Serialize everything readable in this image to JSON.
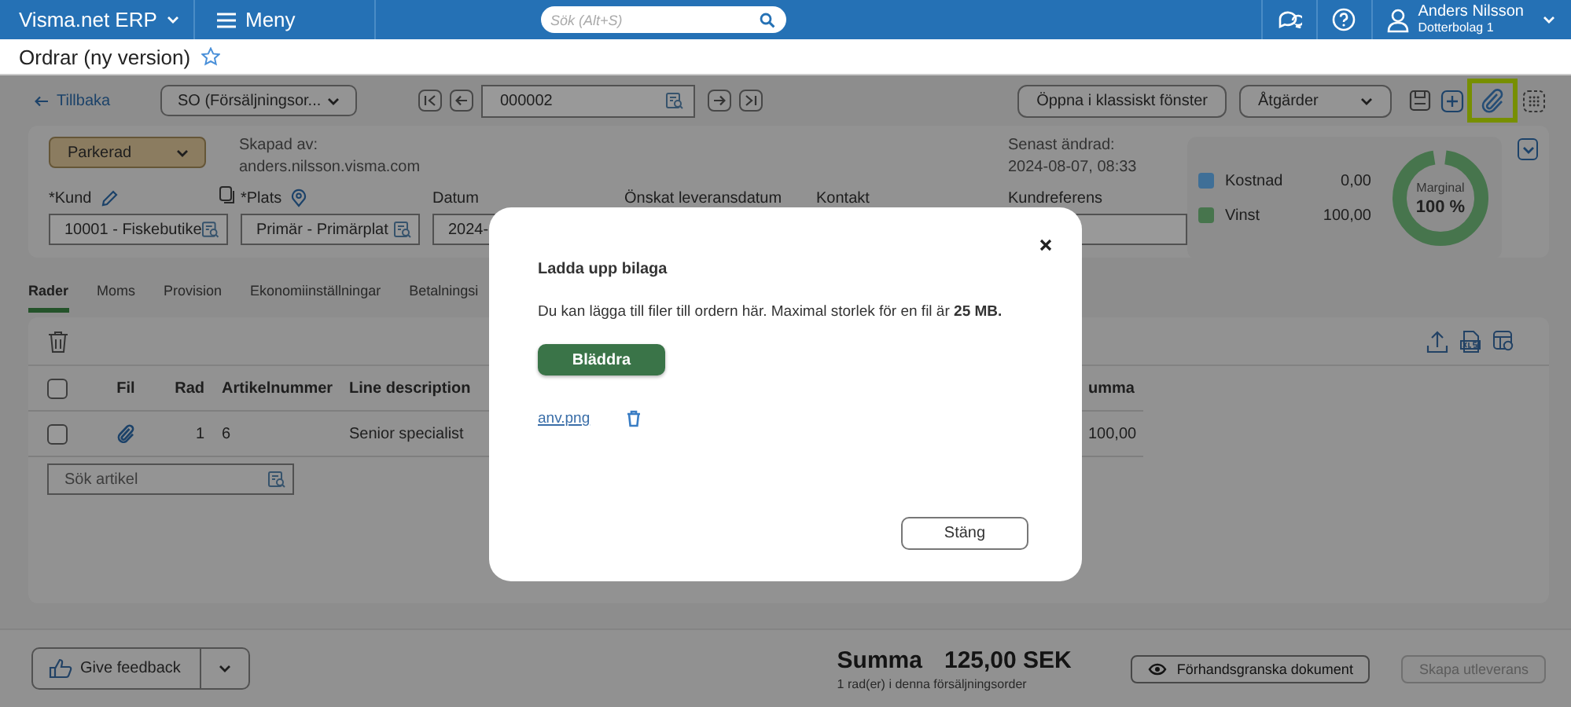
{
  "topbar": {
    "app_name": "Visma.net ERP",
    "menu_label": "Meny",
    "search": {
      "placeholder": "Sök (Alt+S)"
    },
    "user": {
      "name": "Anders Nilsson",
      "company": "Dotterbolag 1"
    }
  },
  "page": {
    "title": "Ordrar (ny version)",
    "favorite": false
  },
  "toolbar": {
    "back": "Tillbaka",
    "order_type": "SO (Försäljningsor...",
    "order_number": "000002",
    "buttons": [
      {
        "label": "Öppna i klassiskt fönster",
        "kind": "button"
      },
      {
        "label": "Åtgärder",
        "kind": "dropdown"
      }
    ],
    "icon_buttons": [
      {
        "kind": "save",
        "highlighted": false
      },
      {
        "kind": "add",
        "highlighted": false
      },
      {
        "kind": "attach",
        "highlighted": true
      },
      {
        "kind": "grid",
        "highlighted": false
      }
    ]
  },
  "header": {
    "status": "Parkerad",
    "created_by_label": "Skapad av:",
    "created_by": "anders.nilsson.visma.com",
    "modified_label": "Senast ändrad:",
    "modified": "2024-08-07, 08:33",
    "fields": [
      {
        "label": "*Kund",
        "kind": "lookup",
        "editable": true,
        "copyable": true,
        "located": false,
        "value": "10001 - Fiskebutike"
      },
      {
        "label": "*Plats",
        "kind": "lookup",
        "editable": false,
        "copyable": false,
        "located": true,
        "value": "Primär - Primärplat"
      },
      {
        "label": "Datum",
        "kind": "text",
        "value": "2024-"
      },
      {
        "label": "Önskat leveransdatum",
        "kind": "label"
      },
      {
        "label": "Kontakt",
        "kind": "label"
      },
      {
        "label": "Kundreferens",
        "kind": "text"
      }
    ],
    "summary": {
      "legend": [
        {
          "label": "Kostnad",
          "value": "0,00",
          "color": "#3f6f97"
        },
        {
          "label": "Vinst",
          "value": "100,00",
          "color": "#47754d"
        }
      ],
      "margin": {
        "label": "Marginal",
        "value": "100 %",
        "level": 1
      }
    }
  },
  "tabs": [
    {
      "label": "Rader",
      "selected": true
    },
    {
      "label": "Moms",
      "selected": false
    },
    {
      "label": "Provision",
      "selected": false
    },
    {
      "label": "Ekonomiinställningar",
      "selected": false
    },
    {
      "label": "Betalningsi",
      "selected": false
    }
  ],
  "table": {
    "all_checked": false,
    "columns": [
      "Fil",
      "Rad",
      "Artikelnummer",
      "Line description",
      "umma"
    ],
    "rows": [
      {
        "checked": false,
        "has_file": true,
        "cells": [
          "",
          "1",
          "6",
          "Senior specialist",
          "100,00"
        ]
      }
    ],
    "search": {
      "placeholder": "Sök artikel"
    }
  },
  "footer": {
    "feedback": "Give feedback",
    "total_label": "Summa",
    "total": "125,00 SEK",
    "row_count": "1 rad(er) i denna försäljningsorder",
    "buttons": [
      {
        "label": "Förhandsgranska dokument",
        "kind": "preview",
        "disabled": false
      },
      {
        "label": "Skapa utleverans",
        "kind": "plain",
        "disabled": true
      }
    ]
  },
  "dialog": {
    "title": "Ladda upp bilaga",
    "text": "Du kan lägga till filer till ordern här. Maximal storlek för en fil är **25 MB.**",
    "browse": "Bläddra",
    "files": [
      {
        "name": "anv.png"
      }
    ],
    "close": "Stäng"
  }
}
